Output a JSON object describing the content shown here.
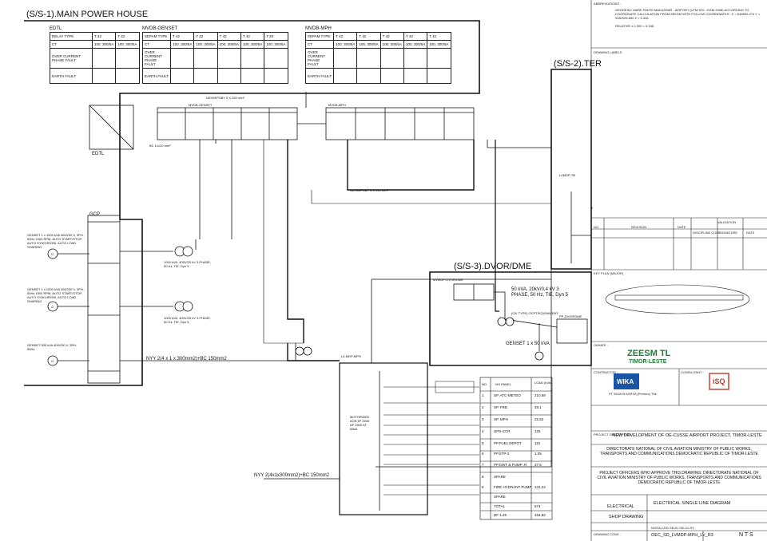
{
  "sections": {
    "s1": "(S/S-1).MAIN POWER HOUSE",
    "s2": "(S/S-2).TER",
    "s3": "(S/S-3).DVOR/DME"
  },
  "edtl": {
    "name": "EDTL",
    "table_title": "EDTL",
    "relay_type": "RELAY TYPE",
    "relay_cols": [
      "T 42",
      "T 42"
    ],
    "ct": "CT",
    "ct_vals": [
      "100, 300/5A",
      "100, 300/5A"
    ],
    "over_current": "OVER CURRENT PHASE FAULT",
    "earth_fault": "EARTH FAULT"
  },
  "mvdb_genset": {
    "table_title": "MVDB-GENSET",
    "panel_title": "MVDB-GENSET",
    "sepam_type": "SEPAM TYPE",
    "cols": [
      "T 42",
      "T 42",
      "T 42",
      "T 42",
      "T 20"
    ]
  },
  "mvdb_mph": {
    "table_title": "MVDB-MPH",
    "panel_title": "MVDB-MPH",
    "sepam_type": "SEPAM TYPE",
    "cols": [
      "T 42",
      "T 42",
      "T 42",
      "T 42",
      "T 42"
    ]
  },
  "cables": {
    "c1": "N2XSEFGBY 3 X 240 mm²",
    "c2": "N2XSEFGBY 3 X 240 mm²",
    "nyy_main": "NYY 2(4 x 1 x 300mm2)+BC 150mm2",
    "nyy_lv": "NYY 2(4x1x300mm2)+BC 150mm2",
    "bc": "BC 1x120 mm²"
  },
  "gcp": {
    "label": "GCP",
    "genset1": "GENSET 1 x 1000 kVA 400/230 V, 3PH, 50Hz 1500 RPM, AUTO START/STOP, AUTO SYNCHRONI, AUTO LOAD SHARING",
    "genset2": "GENSET 1 x 1000 kVA 400/230 V, 3PH, 50Hz 1500 RPM, AUTO START/STOP, AUTO SYNCHRONI, AUTO LOAD SHARING",
    "genset3": "GENSET 500 kVA 400/230 V, 3PH, 50Hz",
    "g": "G"
  },
  "transformers": {
    "t1": "1000 kVA, 400V/20 kV 3 PHASE, 50 Hz, TIE, Dyn 5",
    "t2": "1000 kVA, 400V/20 kV 3 PHASE, 50 Hz, TIE, Dyn 5",
    "t3": "50 kVA, 20kV/0,4 kV 3 PHASE, 50 Hz, TIE, Dyn 5",
    "t3_label": "(OIL TYPE) OCPT/EQUIVALENT",
    "genset_dvor": "GENSET 1 x 50 kVA",
    "pp_dvor": "PP-DVOR/DME"
  },
  "lvmdp": {
    "mph": "LV-MDP-MPH",
    "tb": "LVMDP-TB",
    "mvmdp_dvor": "MVMDP-DVOR/DME",
    "motorized": "MOTORIZED ACB 4P 2500 AF 2500 AT 50kA"
  },
  "load_table": {
    "headers": [
      "NO.",
      "NO PANEL",
      "LOAD (kVA)"
    ],
    "rows": [
      [
        "1",
        "SP. ATC-METEO",
        "210.59"
      ],
      [
        "2",
        "SP. FRB",
        "28.1"
      ],
      [
        "3",
        "SP. MPH",
        "22.52"
      ],
      [
        "4",
        "UPS-CCR",
        "125"
      ],
      [
        "5",
        "PP.FUEL DEPOT",
        "110"
      ],
      [
        "6",
        "PP.STP-3",
        "1.05"
      ],
      [
        "7",
        "PP.GWT & PUMP .R",
        "37.5"
      ],
      [
        "8",
        "SPARE",
        ""
      ],
      [
        "9",
        "FIRE HYDRANT PUMP",
        "131.24"
      ],
      [
        "",
        "SPARE",
        ""
      ],
      [
        "",
        "TOTAL",
        "674"
      ],
      [
        "",
        "DF  1.45",
        "464.82"
      ]
    ]
  },
  "title_block": {
    "notes_head": "ABBREVIATIONS :",
    "note1": "GEODESIC MARK PANTE MAKASSAR - AIRPORT (UTM 51S - EGM 2008) ACCORDING TO COORDINATE CALCULATION FROM ZEESM WITH FOLLOW COORDINATES : X = 648592.074  Y = 9082925.840  Z = 5.346",
    "note2": "RELATIVE ± 0.300 = 5.346",
    "drawing_labels": "DRAWING LABELS",
    "validation": "VALIDATION",
    "revision": "REVISION",
    "no": "NO.",
    "date": "DATE",
    "discipline_code": "DISCIPLINE CODE",
    "signature": "SIGNATURE",
    "date2": "DATE",
    "key_plan": "KEY PLAN (MAJOR)",
    "owner": "OWNER :",
    "zeesm": "ZEESM TL",
    "timor": "TIMOR-LESTE",
    "contractor": "CONTRACTOR :",
    "consultant": "CONSULTANT :",
    "wika": "WIKA",
    "wika_sub": "PT WIJAYA KARYA (Persero) Tbk",
    "isq": "iSQ",
    "project_label": "PROJECT DESCRIPTION :",
    "project": "NEW DEVELOPMENT OF OÉ-CUSSE AIRPORT PROJECT, TIMOR-LESTE",
    "approval": "DIRECTORATE NATIONAL OF CIVIL AVIATION MINISTRY OF PUBLIC WORKS, TRANSPORTS AND COMMUNICATIONS DEMOCRATIC REPUBLIC OF TIMOR-LESTE",
    "officers": "PROJECT OFFICERS WHO APPROVE THIS DRAWING: DIRECTORATE NATIONAL OF CIVIL AVIATION MINISTRY OF PUBLIC WORKS, TRANSPORTS AND COMMUNICATIONS DEMOCRATIC REPUBLIC OF TIMOR-LESTE",
    "discipline": "ELECTRICAL",
    "drawing_title": "ELECTRICAL SINGLE LINE DIAGRAM",
    "drawing_phase": "SHOP DRAWING",
    "drawing_code_label": "DRAWING CODE :",
    "drawing_code": "OEC_SD_LVMDP-MPH_LV_R3",
    "drawing_no": "NOOA-CDD-TB-EI-750-01-R3",
    "scale": "N T S"
  }
}
